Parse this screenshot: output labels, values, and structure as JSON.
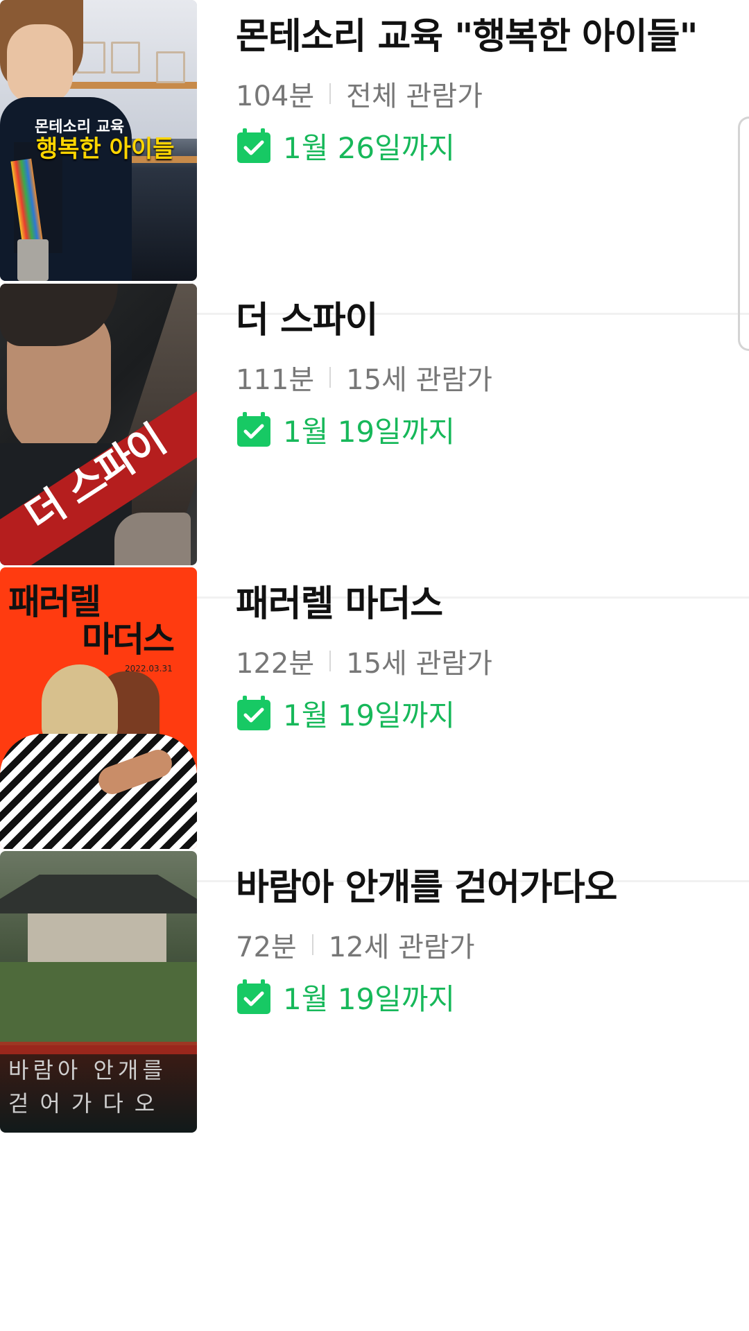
{
  "movies": [
    {
      "title": "몬테소리 교육 \"행복한 아이들\"",
      "runtime": "104분",
      "rating": "전체 관람가",
      "until": "1월 26일까지",
      "poster_text": [
        "몬테소리 교육",
        "행복한 아이들"
      ]
    },
    {
      "title": "더 스파이",
      "runtime": "111분",
      "rating": "15세 관람가",
      "until": "1월 19일까지",
      "poster_text": [
        "더 스파이"
      ]
    },
    {
      "title": "패러렐 마더스",
      "runtime": "122분",
      "rating": "15세 관람가",
      "until": "1월 19일까지",
      "poster_text": [
        "패러렐",
        "마더스",
        "2022.03.31"
      ]
    },
    {
      "title": "바람아 안개를 걷어가다오",
      "runtime": "72분",
      "rating": "12세 관람가",
      "until": "1월 19일까지",
      "poster_text": [
        "바람아 안개를",
        "걷어가다오"
      ]
    }
  ],
  "icons": {
    "calendar_check": "calendar-check-icon"
  },
  "colors": {
    "accent_green": "#17b85a",
    "title_text": "#111111",
    "meta_text": "#777777",
    "divider": "#f1f1f1"
  }
}
